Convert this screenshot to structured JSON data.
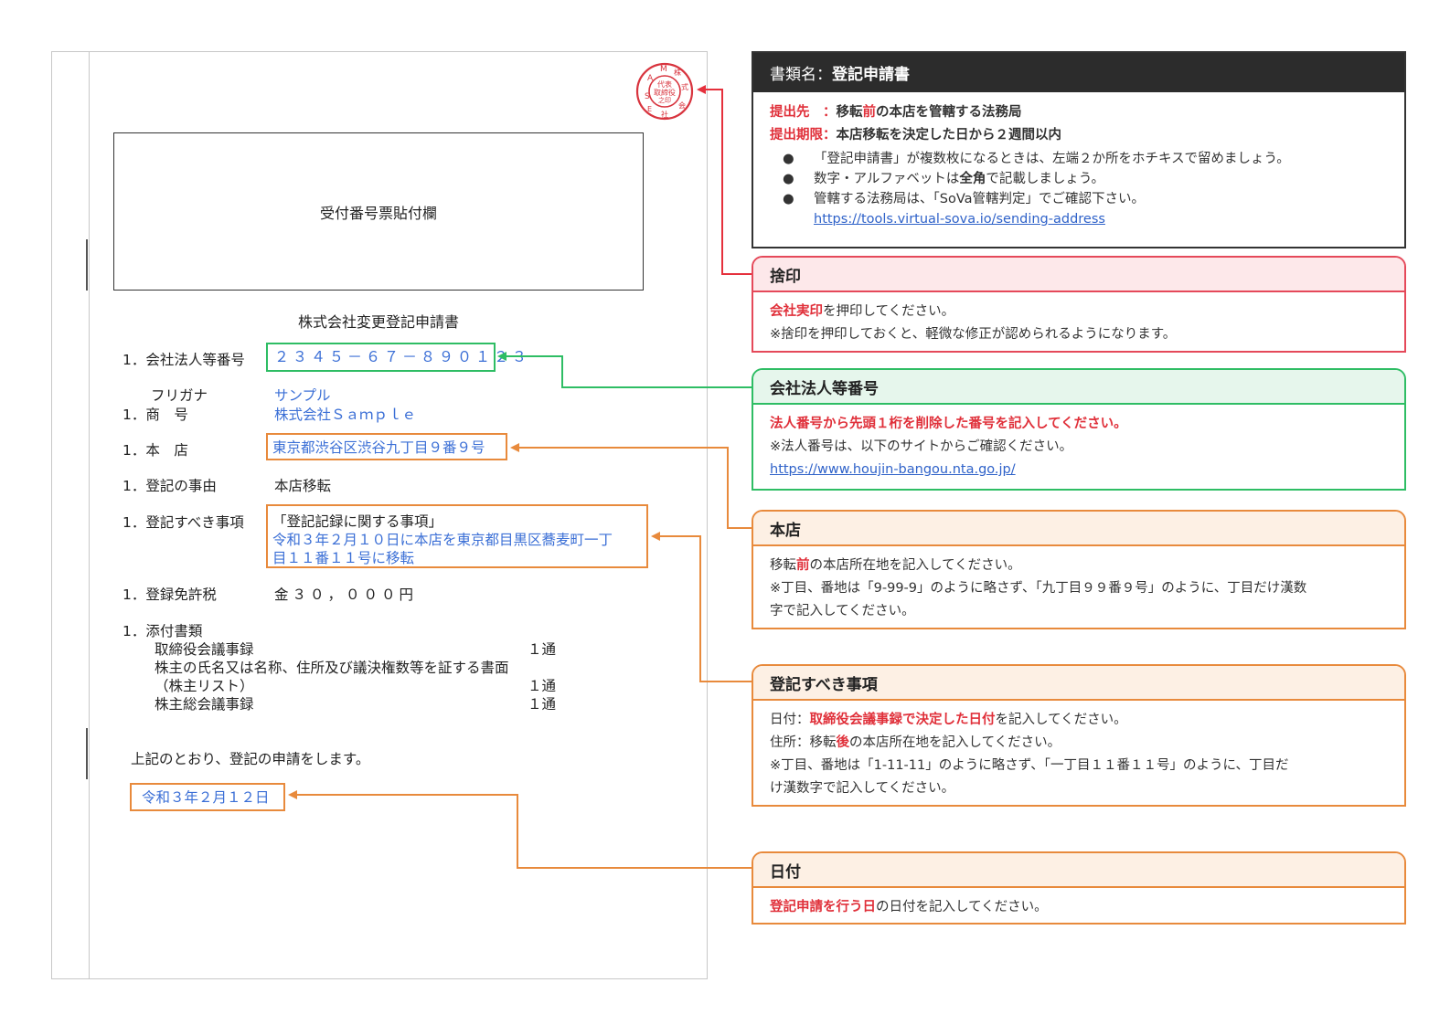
{
  "document": {
    "receipt_label": "受付番号票貼付欄",
    "title": "株式会社変更登記申請書",
    "rows": {
      "corp_number": {
        "label": "1．会社法人等番号",
        "value": "２３４５－６７－８９０１２３"
      },
      "furigana": {
        "label": "フリガナ",
        "value": "サンプル"
      },
      "trade_name": {
        "label": "1．商　号",
        "value": "株式会社Ｓａｍｐｌｅ"
      },
      "head_office": {
        "label": "1．本　店",
        "value": "東京都渋谷区渋谷九丁目９番９号"
      },
      "reason": {
        "label": "1．登記の事由",
        "value": "本店移転"
      },
      "matters": {
        "label": "1．登記すべき事項",
        "heading": "「登記記録に関する事項」",
        "line1": "令和３年２月１０日に本店を東京都目黒区蕎麦町一丁",
        "line2": "目１１番１１号に移転"
      },
      "tax": {
        "label": "1．登録免許税",
        "value": "金３０，０００円"
      },
      "attachments": {
        "label": "1．添付書類",
        "items": [
          {
            "name": "取締役会議事録",
            "count": "１通"
          },
          {
            "name": "株主の氏名又は名称、住所及び議決権数等を証する書面",
            "count": ""
          },
          {
            "name": "（株主リスト）",
            "count": "１通"
          },
          {
            "name": "株主総会議事録",
            "count": "１通"
          }
        ]
      }
    },
    "closing": "上記のとおり、登記の申請をします。",
    "date": "令和３年２月１２日",
    "seal_text": "SAMPLE株式会社 代表取締役印"
  },
  "info": {
    "title_prefix": "書類名：",
    "title_name": "登記申請書",
    "dest_label": "提出先　：",
    "dest_text_a": "移転",
    "dest_text_b": "前",
    "dest_text_c": "の本店を管轄する法務局",
    "deadline_label": "提出期限：",
    "deadline_text": "本店移転を決定した日から２週間以内",
    "bullet": "●",
    "bullets": [
      "「登記申請書」が複数枚になるときは、左端２か所をホチキスで留めましょう。",
      "管轄する法務局は、「SoVa管轄判定」でご確認下さい。"
    ],
    "bullet2_a": "数字・アルファベットは",
    "bullet2_b": "全角",
    "bullet2_c": "で記載しましょう。",
    "link": "https://tools.virtual-sova.io/sending-address"
  },
  "seal_panel": {
    "title": "捨印",
    "line1_red": "会社実印",
    "line1_rest": "を押印してください。",
    "line2": "※捨印を押印しておくと、軽微な修正が認められるようになります。"
  },
  "corp_panel": {
    "title": "会社法人等番号",
    "line1": "法人番号から先頭１桁を削除した番号を記入してください。",
    "line2": "※法人番号は、以下のサイトからご確認ください。",
    "link": "https://www.houjin-bangou.nta.go.jp/"
  },
  "hq_panel": {
    "title": "本店",
    "line1_a": "移転",
    "line1_b": "前",
    "line1_c": "の本店所在地を記入してください。",
    "line2": "※丁目、番地は「9-99-9」のように略さず、「九丁目９９番９号」のように、丁目だけ漢数",
    "line3": "字で記入してください。"
  },
  "reg_panel": {
    "title": "登記すべき事項",
    "line1_a": "日付：",
    "line1_b": "取締役会議事録で決定した日付",
    "line1_c": "を記入してください。",
    "line2_a": "住所：移転",
    "line2_b": "後",
    "line2_c": "の本店所在地を記入してください。",
    "line3": "※丁目、番地は「1-11-11」のように略さず、「一丁目１１番１１号」のように、丁目だ",
    "line4": "け漢数字で記入してください。"
  },
  "date_panel": {
    "title": "日付",
    "line1_red": "登記申請を行う日",
    "line1_rest": "の日付を記入してください。"
  },
  "colors": {
    "red": "#e0303a",
    "green": "#2ebd64",
    "orange": "#e88a3c",
    "blue": "#3b6fd6",
    "dark": "#2c2c2c"
  }
}
